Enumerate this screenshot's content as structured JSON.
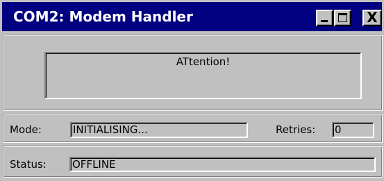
{
  "window": {
    "title": "COM2: Modem Handler",
    "buttons": {
      "minimize": "minimize",
      "maximize": "maximize",
      "close": "X"
    }
  },
  "message": {
    "text": "ATtention!"
  },
  "mode": {
    "label": "Mode:",
    "value": "INITIALISING..."
  },
  "retries": {
    "label": "Retries:",
    "value": "0"
  },
  "status": {
    "label": "Status:",
    "value": "OFFLINE"
  },
  "colors": {
    "titlebar": "#000080",
    "face": "#c0c0c0",
    "title_text": "#ffffff"
  },
  "icons": {
    "minimize": "minimize-icon",
    "maximize": "maximize-icon",
    "close": "close-icon"
  }
}
